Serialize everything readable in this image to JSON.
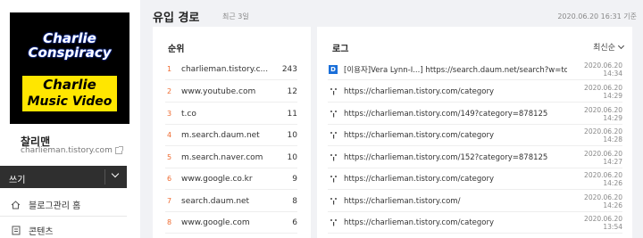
{
  "sidebar": {
    "cover_lines": [
      "Charlie",
      "Conspiracy",
      "Charlie",
      "Music Video"
    ],
    "blog_name": "찰리맨",
    "blog_url": "charlieman.tistory.com",
    "write_label": "쓰기",
    "menu": [
      {
        "label": "블로그관리 홈",
        "icon": "home-icon"
      },
      {
        "label": "콘텐츠",
        "icon": "document-icon"
      }
    ]
  },
  "header": {
    "title": "유입 경로",
    "subtitle": "최근 3일",
    "timestamp": "2020.06.20 16:31 기준"
  },
  "rank_panel": {
    "heading": "순위",
    "rows": [
      {
        "rank": "1",
        "domain": "charlieman.tistory.c...",
        "count": "243"
      },
      {
        "rank": "2",
        "domain": "www.youtube.com",
        "count": "12"
      },
      {
        "rank": "3",
        "domain": "t.co",
        "count": "11"
      },
      {
        "rank": "4",
        "domain": "m.search.daum.net",
        "count": "10"
      },
      {
        "rank": "5",
        "domain": "m.search.naver.com",
        "count": "10"
      },
      {
        "rank": "6",
        "domain": "www.google.co.kr",
        "count": "9"
      },
      {
        "rank": "7",
        "domain": "search.daum.net",
        "count": "8"
      },
      {
        "rank": "8",
        "domain": "www.google.com",
        "count": "6"
      }
    ]
  },
  "log_panel": {
    "heading": "로그",
    "sort_label": "최신순",
    "rows": [
      {
        "icon": "daum-icon",
        "badge": "D",
        "url": "[이용자]Vera Lynn-I...] https://search.daum.net/search?w=tot&DA...",
        "time": "2020.06.20 14:34"
      },
      {
        "icon": "link-icon",
        "url": "https://charlieman.tistory.com/category",
        "time": "2020.06.20 14:29"
      },
      {
        "icon": "link-icon",
        "url": "https://charlieman.tistory.com/149?category=878125",
        "time": "2020.06.20 14:29"
      },
      {
        "icon": "link-icon",
        "url": "https://charlieman.tistory.com/category",
        "time": "2020.06.20 14:28"
      },
      {
        "icon": "link-icon",
        "url": "https://charlieman.tistory.com/152?category=878125",
        "time": "2020.06.20 14:27"
      },
      {
        "icon": "link-icon",
        "url": "https://charlieman.tistory.com/category",
        "time": "2020.06.20 14:26"
      },
      {
        "icon": "link-icon",
        "url": "https://charlieman.tistory.com/",
        "time": "2020.06.20 14:26"
      },
      {
        "icon": "link-icon",
        "url": "https://charlieman.tistory.com/category",
        "time": "2020.06.20 13:54"
      }
    ]
  },
  "colors": {
    "rank_accent": "#ef6b30",
    "daum_badge": "#1a6fd9",
    "write_bar": "#2f2f2f",
    "cover_yellow": "#ffe600"
  }
}
